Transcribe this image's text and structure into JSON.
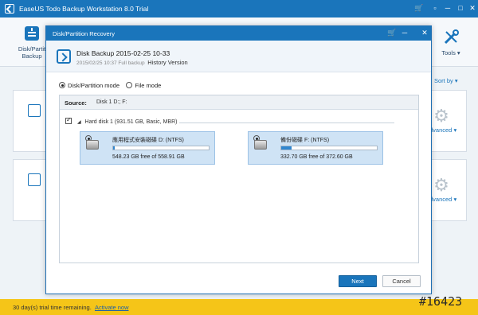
{
  "app": {
    "title": "EaseUS Todo Backup Workstation 8.0 Trial",
    "window_controls": [
      "🛒",
      "▫",
      "─",
      "□",
      "✕"
    ]
  },
  "toolbar": {
    "disk_partition_backup": "Disk/Partit\nBackup",
    "tools": "Tools ▾"
  },
  "main": {
    "sort_by": "Sort by ▾",
    "advanced_1": "dvanced ▾",
    "advanced_2": "dvanced ▾"
  },
  "status": {
    "message": "30 day(s) trial time remaining.",
    "activate": "Activate now"
  },
  "watermark": "#16423",
  "dialog": {
    "title": "Disk/Partition Recovery",
    "backup_name": "Disk Backup 2015-02-25 10-33",
    "backup_meta": "2015/02/25 10:37 Full backup",
    "history_version": "History Version",
    "modes": {
      "partition": "Disk/Partition mode",
      "file": "File mode"
    },
    "source_label": "Source:",
    "source_value": "Disk 1 D:; F:",
    "disk_label": "Hard disk 1 (931.51 GB, Basic, MBR)",
    "partitions": [
      {
        "name": "應用程式安裝磁碟 D: (NTFS)",
        "free": "548.23 GB free of 558.91 GB",
        "used_fraction": 0.02
      },
      {
        "name": "備份磁碟 F: (NTFS)",
        "free": "332.70 GB free of 372.60 GB",
        "used_fraction": 0.11
      }
    ],
    "next": "Next",
    "cancel": "Cancel"
  },
  "colors": {
    "accent": "#1a75bb",
    "trial_bar": "#f5c518",
    "partition_fill": "#cfe3f5"
  }
}
